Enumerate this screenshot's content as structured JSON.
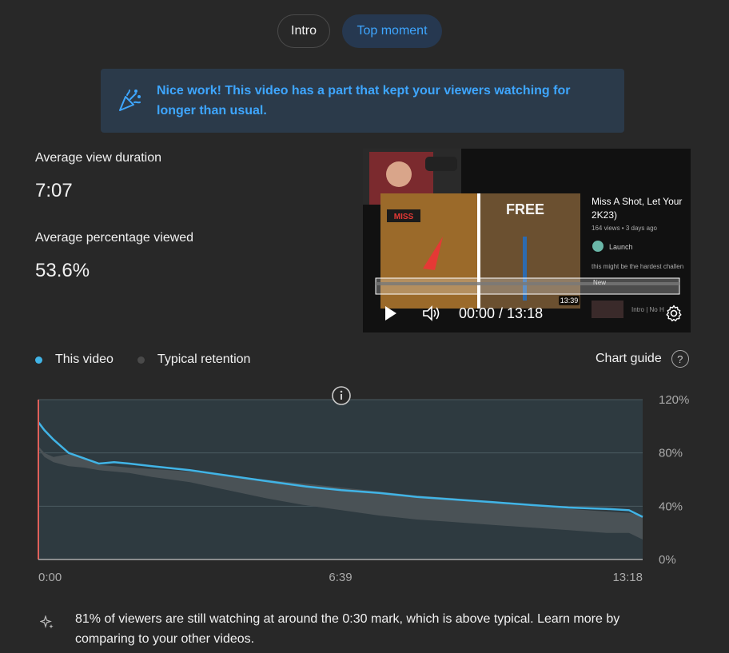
{
  "tabs": [
    {
      "label": "Intro"
    },
    {
      "label": "Top moment"
    }
  ],
  "banner": {
    "message": "Nice work! This video has a part that kept your viewers watching for longer than usual."
  },
  "stats": {
    "avg_duration_label": "Average view duration",
    "avg_duration_value": "7:07",
    "avg_pct_label": "Average percentage viewed",
    "avg_pct_value": "53.6%"
  },
  "player": {
    "video_title": "Miss A Shot, Let Your",
    "video_title_2": "2K23)",
    "meta": "164 views • 3 days ago",
    "channel": "Launch",
    "description": "this might be the hardest challen",
    "new_badge": "New",
    "thumb_duration": "13:39",
    "thumb_text_miss": "MISS",
    "thumb_text_free": "FREE",
    "next_title": "Intro | No H",
    "time": "00:00 / 13:18"
  },
  "legend": {
    "this_video": "This video",
    "typical": "Typical retention",
    "this_video_color": "#3ea6ff",
    "typical_color": "#717171"
  },
  "chart_guide": {
    "label": "Chart guide"
  },
  "chart_data": {
    "type": "area",
    "x_ticks": [
      "0:00",
      "6:39",
      "13:18"
    ],
    "y_ticks": [
      "120%",
      "80%",
      "40%",
      "0%"
    ],
    "ylim": [
      0,
      120
    ],
    "xlim_seconds": [
      0,
      798
    ],
    "series": [
      {
        "name": "This video",
        "x": [
          0,
          8,
          20,
          40,
          60,
          80,
          100,
          120,
          150,
          200,
          250,
          300,
          350,
          400,
          450,
          500,
          550,
          600,
          650,
          700,
          750,
          780,
          798
        ],
        "values": [
          103,
          97,
          90,
          80,
          76,
          72,
          73,
          72,
          70,
          67,
          63,
          59,
          55,
          52,
          50,
          47,
          45,
          43,
          41,
          39,
          38,
          37,
          32
        ]
      },
      {
        "name": "Typical retention",
        "x": [
          0,
          8,
          20,
          40,
          60,
          80,
          100,
          120,
          150,
          200,
          250,
          300,
          350,
          400,
          450,
          500,
          550,
          600,
          650,
          700,
          750,
          780,
          798
        ],
        "upper": [
          85,
          80,
          77,
          79,
          77,
          71,
          70,
          69,
          68,
          66,
          63,
          60,
          57,
          54,
          51,
          48,
          46,
          43,
          40,
          38,
          36,
          35,
          33
        ],
        "lower": [
          83,
          77,
          73,
          70,
          69,
          67,
          66,
          65,
          62,
          58,
          52,
          46,
          41,
          37,
          33,
          30,
          28,
          26,
          24,
          22,
          20,
          20,
          15
        ]
      }
    ]
  },
  "insight": {
    "text": "81% of viewers are still watching at around the 0:30 mark, which is above typical. Learn more by comparing to your other videos."
  }
}
